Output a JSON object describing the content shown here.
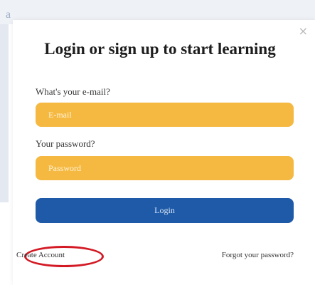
{
  "background": {
    "partial_text": "a"
  },
  "modal": {
    "close_glyph": "×",
    "title": "Login or sign up to start learning",
    "email_label": "What's your e-mail?",
    "email_placeholder": "E-mail",
    "email_value": "",
    "password_label": "Your password?",
    "password_placeholder": "Password",
    "password_value": "",
    "login_label": "Login",
    "create_account_label": "Create Account",
    "forgot_password_label": "Forgot your password?"
  },
  "colors": {
    "field_bg": "#f5b942",
    "button_bg": "#1e5aa8",
    "annotation": "#d31a24"
  },
  "icons": {
    "close": "close-icon"
  }
}
